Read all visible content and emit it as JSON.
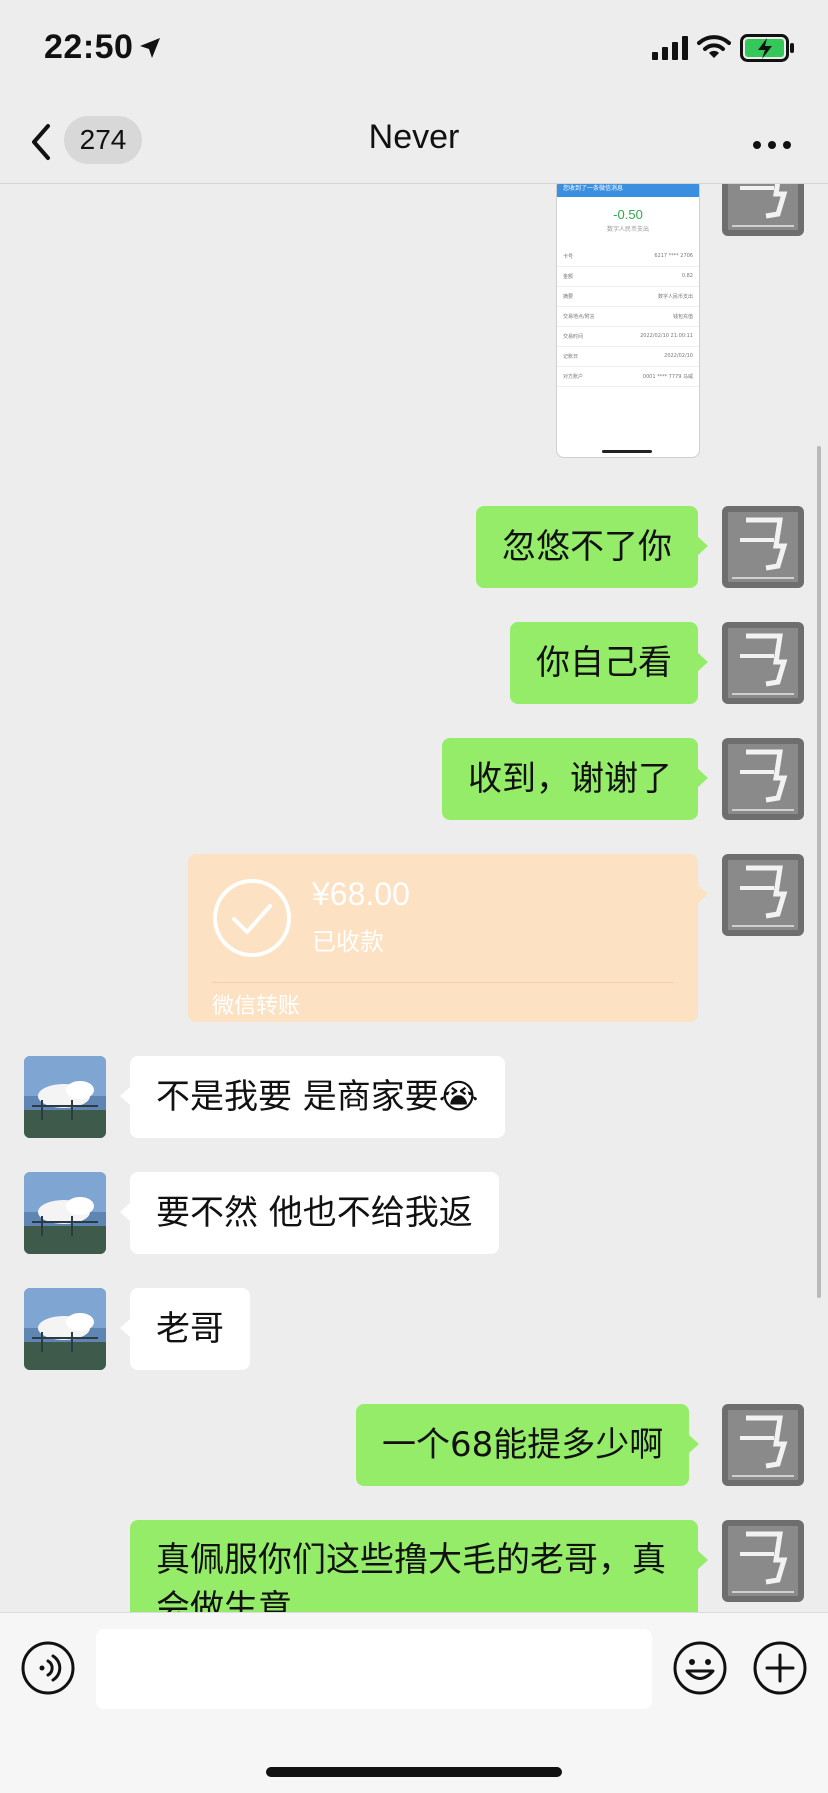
{
  "status_bar": {
    "time": "22:50"
  },
  "nav": {
    "unread_count": "274",
    "title": "Never"
  },
  "screenshot_message": {
    "header": "您收到了一条微信消息",
    "amount": "-0.50",
    "subtitle": "数字人民币支出",
    "rows": [
      {
        "label": "卡号",
        "value": "6217 **** 2706"
      },
      {
        "label": "金额",
        "value": "0.82"
      },
      {
        "label": "摘要",
        "value": "数字人民币支出"
      },
      {
        "label": "交易地点/附言",
        "value": "钱包充值"
      },
      {
        "label": "交易时间",
        "value": "2022/02/10 21:00:11"
      },
      {
        "label": "记账日",
        "value": "2022/02/10"
      },
      {
        "label": "对方账户",
        "value": "0001 **** 7779 马威"
      }
    ]
  },
  "messages": [
    {
      "sender": "me",
      "text": "忽悠不了你"
    },
    {
      "sender": "me",
      "text": "你自己看"
    },
    {
      "sender": "me",
      "text": "收到，谢谢了"
    },
    {
      "sender": "them",
      "text": "不是我要  是商家要😭"
    },
    {
      "sender": "them",
      "text": "要不然  他也不给我返"
    },
    {
      "sender": "them",
      "text": "老哥"
    },
    {
      "sender": "me",
      "text": "一个68能提多少啊"
    },
    {
      "sender": "me",
      "text": "真佩服你们这些撸大毛的老哥，真会做生意"
    }
  ],
  "transfer": {
    "amount": "¥68.00",
    "status": "已收款",
    "label": "微信转账"
  },
  "input": {
    "placeholder": ""
  },
  "icons": {
    "back": "chevron-left-icon",
    "more": "more-icon",
    "voice": "voice-icon",
    "emoji": "emoji-icon",
    "plus": "plus-icon",
    "check": "check-circle-icon"
  },
  "colors": {
    "my_bubble": "#95ec69",
    "their_bubble": "#ffffff",
    "transfer_bubble": "#fde1c3",
    "background": "#ededed"
  }
}
